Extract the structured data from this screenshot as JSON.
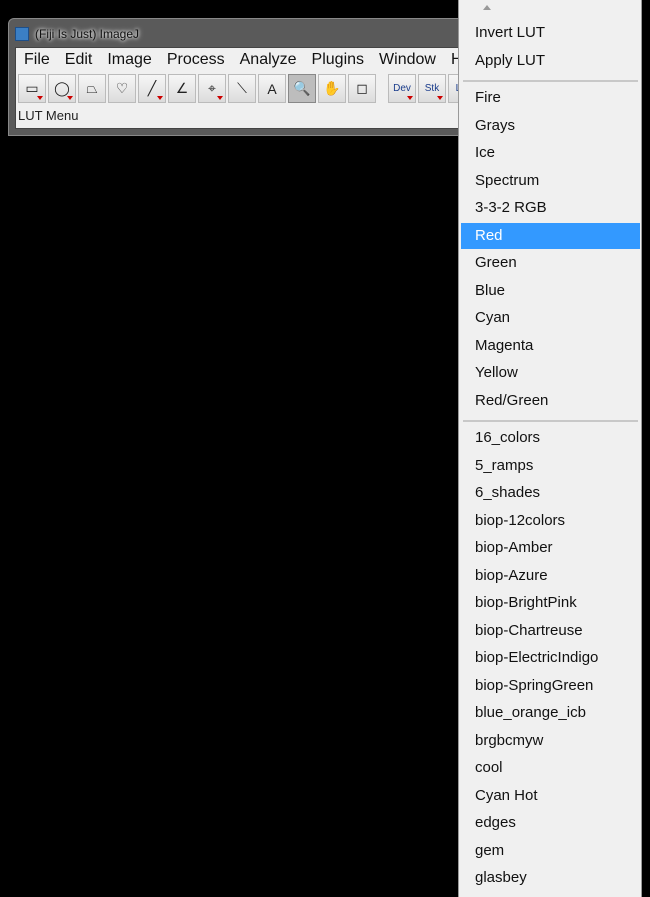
{
  "window": {
    "title": "(Fiji Is Just) ImageJ",
    "status": "LUT Menu"
  },
  "menubar": [
    "File",
    "Edit",
    "Image",
    "Process",
    "Analyze",
    "Plugins",
    "Window",
    "He"
  ],
  "toolbar": [
    {
      "name": "rectangle-tool",
      "glyph": "▭",
      "tri": true
    },
    {
      "name": "oval-tool",
      "glyph": "◯",
      "tri": true
    },
    {
      "name": "polygon-tool",
      "glyph": "⏢",
      "tri": false
    },
    {
      "name": "freehand-tool",
      "glyph": "♡",
      "tri": false
    },
    {
      "name": "line-tool",
      "glyph": "╱",
      "tri": true
    },
    {
      "name": "angle-tool",
      "glyph": "∠",
      "tri": false
    },
    {
      "name": "point-tool",
      "glyph": "⌖",
      "tri": true
    },
    {
      "name": "wand-tool",
      "glyph": "⟍",
      "tri": false
    },
    {
      "name": "text-tool",
      "glyph": "A",
      "tri": false
    },
    {
      "name": "zoom-tool",
      "glyph": "🔍",
      "tri": false,
      "selected": true
    },
    {
      "name": "hand-tool",
      "glyph": "✋",
      "tri": false
    },
    {
      "name": "dropper-tool",
      "glyph": "◻",
      "tri": false
    }
  ],
  "toolbar_menus": [
    {
      "label": "Dev"
    },
    {
      "label": "Stk"
    },
    {
      "label": "LU"
    }
  ],
  "lut_menu": {
    "top": [
      "Invert LUT",
      "Apply LUT"
    ],
    "basic": [
      "Fire",
      "Grays",
      "Ice",
      "Spectrum",
      "3-3-2 RGB",
      "Red",
      "Green",
      "Blue",
      "Cyan",
      "Magenta",
      "Yellow",
      "Red/Green"
    ],
    "highlighted": "Red",
    "more": [
      "16_colors",
      "5_ramps",
      "6_shades",
      "biop-12colors",
      "biop-Amber",
      "biop-Azure",
      "biop-BrightPink",
      "biop-Chartreuse",
      "biop-ElectricIndigo",
      "biop-SpringGreen",
      "blue_orange_icb",
      "brgbcmyw",
      "cool",
      "Cyan Hot",
      "edges",
      "gem",
      "glasbey"
    ]
  }
}
